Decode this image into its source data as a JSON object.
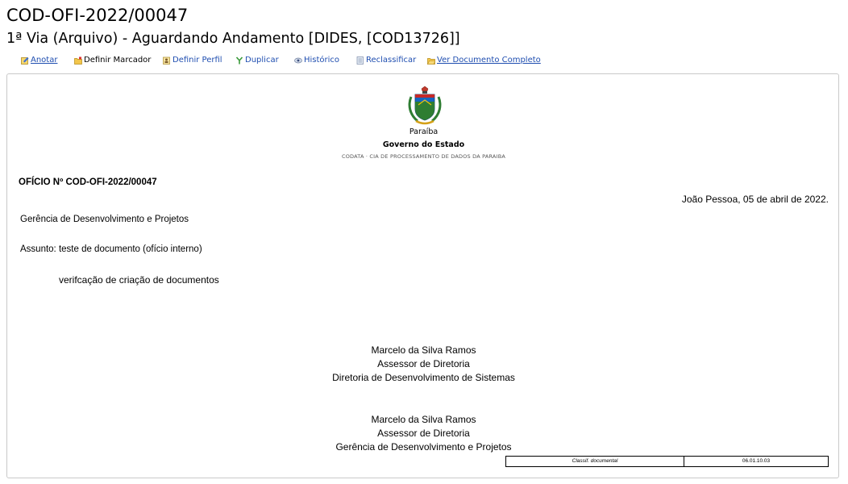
{
  "header": {
    "doc_code": "COD-OFI-2022/00047",
    "status": "1ª Via (Arquivo) - Aguardando Andamento [DIDES, [COD13726]]"
  },
  "toolbar": {
    "items": [
      {
        "label": "Anotar",
        "icon": "note-icon"
      },
      {
        "label": "Definir Marcador",
        "icon": "folder-tag-icon"
      },
      {
        "label": "Definir Perfil",
        "icon": "profile-icon"
      },
      {
        "label": "Duplicar",
        "icon": "duplicate-icon"
      },
      {
        "label": "Histórico",
        "icon": "history-icon"
      },
      {
        "label": "Reclassificar",
        "icon": "reclassify-icon"
      },
      {
        "label": "Ver Documento Completo",
        "icon": "folder-open-icon"
      }
    ]
  },
  "document": {
    "state": "Paraíba",
    "government": "Governo do Estado",
    "org": "CODATA · CIA DE PROCESSAMENTO DE DADOS DA PARAIBA",
    "number": "OFÍCIO Nº COD-OFI-2022/00047",
    "date": "João Pessoa, 05 de abril de 2022.",
    "recipient": "Gerência de Desenvolvimento e Projetos",
    "subject": "Assunto: teste de documento (ofício interno)",
    "body": "verifcação de criação de documentos",
    "signatures": [
      {
        "name": "Marcelo da Silva Ramos",
        "role": "Assessor de Diretoria",
        "unit": "Diretoria de Desenvolvimento de Sistemas"
      },
      {
        "name": "Marcelo da Silva Ramos",
        "role": "Assessor de Diretoria",
        "unit": "Gerência de Desenvolvimento e Projetos"
      }
    ],
    "classification": {
      "label": "Classif. documental",
      "value": "06.01.10.03"
    }
  },
  "colors": {
    "link": "#1f4eb0",
    "border": "#c9c9c9",
    "crest_green": "#2e7d32",
    "crest_blue": "#1565c0"
  }
}
